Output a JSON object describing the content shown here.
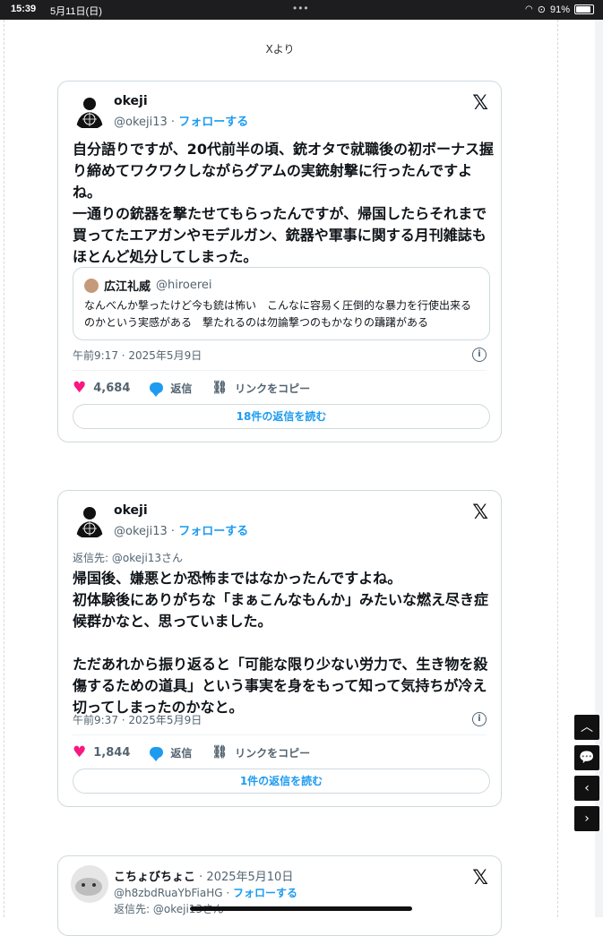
{
  "status": {
    "time": "15:39",
    "date": "5月11日(日)",
    "battery": "91%"
  },
  "source_label": "Xより",
  "tweets": [
    {
      "name": "okeji",
      "handle": "@okeji13",
      "follow": "フォローする",
      "text": "自分語りですが、20代前半の頃、銃オタで就職後の初ボーナス握り締めてワクワクしながらグアムの実銃射撃に行ったんですよね。\n一通りの銃器を撃たせてもらったんですが、帰国したらそれまで買ってたエアガンやモデルガン、銃器や軍事に関する月刊雑誌もほとんど処分してしまった。",
      "quote": {
        "name": "広江礼威",
        "handle": "@hiroerei",
        "text": "なんべんか撃ったけど今も銃は怖い　こんなに容易く圧倒的な暴力を行使出来るのかという実感がある　撃たれるのは勿論撃つのもかなりの躊躇がある"
      },
      "timestamp": "午前9:17 · 2025年5月9日",
      "likes": "4,684",
      "reply_label": "返信",
      "copy_label": "リンクをコピー",
      "read_replies": "18件の返信を読む"
    },
    {
      "name": "okeji",
      "handle": "@okeji13",
      "follow": "フォローする",
      "reply_to": "返信先: @okeji13さん",
      "text": "帰国後、嫌悪とか恐怖まではなかったんですよね。\n初体験後にありがちな「まぁこんなもんか」みたいな燃え尽き症候群かなと、思っていました。\n\nただあれから振り返ると「可能な限り少ない労力で、生き物を殺傷するための道具」という事実を身をもって知って気持ちが冷え切ってしまったのかなと。",
      "timestamp": "午前9:37 · 2025年5月9日",
      "likes": "1,844",
      "reply_label": "返信",
      "copy_label": "リンクをコピー",
      "read_replies": "1件の返信を読む"
    },
    {
      "name": "こちょびちょこ",
      "date": "· 2025年5月10日",
      "handle": "@h8zbdRuaYbFiaHG",
      "follow": "フォローする",
      "reply_to": "返信先: @okeji13さん"
    }
  ],
  "x_logo": "𝕏",
  "icons": {
    "x": "x-logo-icon",
    "heart": "heart-icon",
    "reply": "reply-bubble-icon",
    "link": "link-icon",
    "info": "info-icon",
    "scroll_top": "chevron-up-icon",
    "comment": "comment-icon",
    "prev": "chevron-left-icon",
    "next": "chevron-right-icon"
  },
  "colors": {
    "accent": "#1d9bf0",
    "like": "#f91880"
  }
}
